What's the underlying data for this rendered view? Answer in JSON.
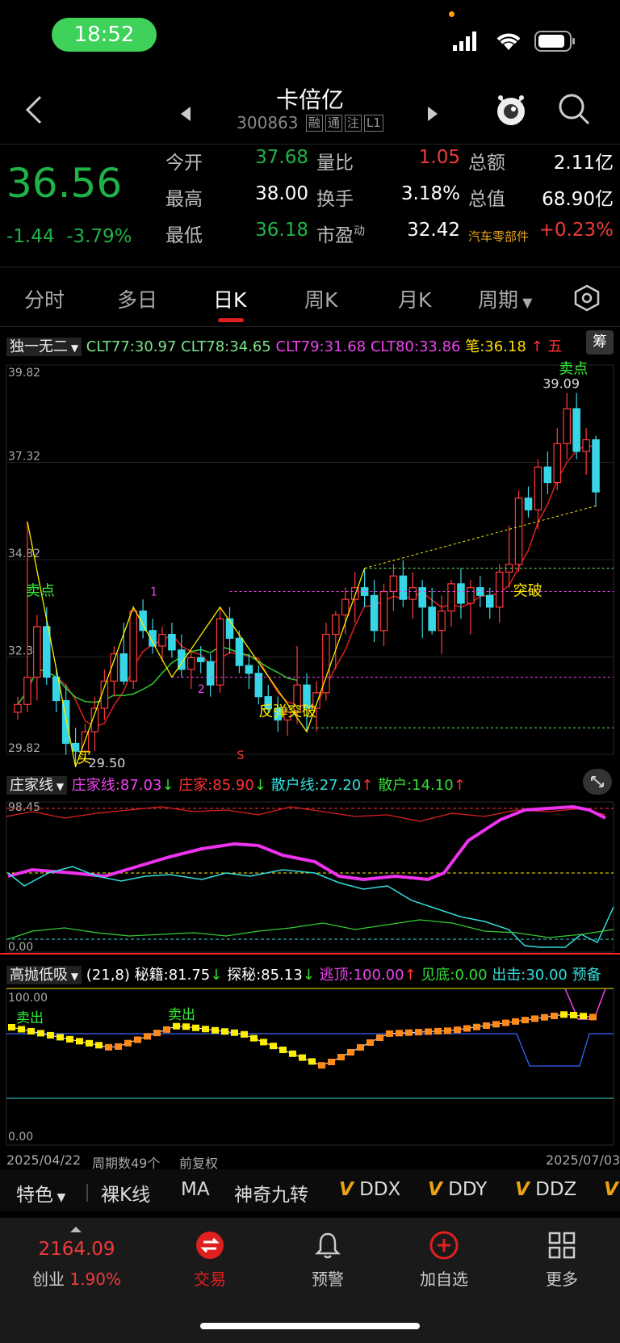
{
  "status_bar": {
    "time": "18:52"
  },
  "header": {
    "title": "卡倍亿",
    "code": "300863",
    "tags": [
      "融",
      "通",
      "注",
      "L1"
    ]
  },
  "quote": {
    "price": "36.56",
    "change": "-1.44",
    "change_pct": "-3.79%",
    "rows": [
      [
        {
          "label": "今开",
          "value": "37.68",
          "color": "#1fb347"
        },
        {
          "label": "量比",
          "value": "1.05",
          "color": "#f03a3a"
        },
        {
          "label": "总额",
          "value": "2.11亿",
          "color": "#ffffff"
        }
      ],
      [
        {
          "label": "最高",
          "value": "38.00",
          "color": "#ffffff"
        },
        {
          "label": "换手",
          "value": "3.18%",
          "color": "#ffffff"
        },
        {
          "label": "总值",
          "value": "68.90亿",
          "color": "#ffffff"
        }
      ],
      [
        {
          "label": "最低",
          "value": "36.18",
          "color": "#1fb347"
        },
        {
          "label": "市盈",
          "value": "32.42",
          "color": "#ffffff"
        },
        {
          "label": "汽车零部件",
          "value": "+0.23%",
          "color": "#f03a3a"
        }
      ]
    ],
    "pe_superscript": "动"
  },
  "tabs": [
    "分时",
    "多日",
    "日K",
    "周K",
    "月K",
    "周期"
  ],
  "main_indicator": {
    "name": "独一无二",
    "values": [
      {
        "text": "CLT77:30.97",
        "color": "#7ee58a"
      },
      {
        "text": "CLT78:34.65",
        "color": "#7ee58a"
      },
      {
        "text": "CLT79:31.68",
        "color": "#ee44ee"
      },
      {
        "text": "CLT80:33.86",
        "color": "#ee44ee"
      },
      {
        "text": "笔:36.18",
        "color": "#ffdd00"
      },
      {
        "text": "↑",
        "color": "#ff3333"
      },
      {
        "text": "五",
        "color": "#ff3333"
      }
    ],
    "calc_button": "筹"
  },
  "chart_data": {
    "type": "candlestick",
    "period": "日K",
    "y_axis_ticks": [
      "39.82",
      "37.32",
      "34.82",
      "32.32",
      "29.82"
    ],
    "ylim": [
      29.82,
      39.82
    ],
    "x_start": "2025/04/22",
    "x_end": "2025/07/03",
    "high_label": "39.09",
    "low_label": "29.50",
    "annotations": [
      {
        "text": "卖点",
        "color": "#33ee33"
      },
      {
        "text": "卖点",
        "color": "#33ee33"
      },
      {
        "text": "反弹突破",
        "color": "#ffee00"
      },
      {
        "text": "突破",
        "color": "#ffee00"
      },
      {
        "text": "买",
        "color": "#ffee00"
      },
      {
        "text": "1",
        "color": "#ee44ee"
      },
      {
        "text": "2",
        "color": "#ee44ee"
      },
      {
        "text": "S",
        "color": "#ff3333"
      }
    ],
    "candles": [
      [
        30.9,
        31.3,
        30.7,
        31.1
      ],
      [
        31.1,
        35.8,
        30.9,
        31.8
      ],
      [
        31.8,
        33.4,
        31.2,
        33.1
      ],
      [
        33.1,
        33.6,
        31.6,
        31.8
      ],
      [
        31.8,
        32.0,
        30.9,
        31.2
      ],
      [
        31.2,
        31.6,
        29.8,
        30.1
      ],
      [
        30.1,
        30.5,
        29.5,
        29.9
      ],
      [
        29.9,
        30.6,
        29.6,
        30.4
      ],
      [
        30.4,
        31.3,
        29.9,
        31.0
      ],
      [
        31.0,
        32.0,
        30.7,
        31.7
      ],
      [
        31.7,
        32.6,
        31.3,
        32.4
      ],
      [
        32.4,
        33.2,
        31.6,
        31.7
      ],
      [
        31.7,
        33.6,
        31.5,
        33.5
      ],
      [
        33.5,
        33.8,
        32.8,
        33.0
      ],
      [
        33.0,
        33.3,
        32.4,
        32.6
      ],
      [
        32.6,
        33.1,
        32.2,
        32.9
      ],
      [
        32.9,
        33.2,
        32.3,
        32.5
      ],
      [
        32.5,
        32.9,
        31.8,
        32.0
      ],
      [
        32.0,
        32.5,
        31.5,
        32.3
      ],
      [
        32.3,
        32.6,
        31.9,
        32.2
      ],
      [
        32.2,
        32.4,
        31.3,
        31.6
      ],
      [
        31.6,
        33.6,
        31.4,
        33.3
      ],
      [
        33.3,
        33.6,
        32.4,
        32.8
      ],
      [
        32.8,
        33.0,
        31.9,
        32.1
      ],
      [
        32.1,
        32.4,
        31.5,
        31.9
      ],
      [
        31.9,
        32.1,
        31.1,
        31.3
      ],
      [
        31.3,
        31.6,
        30.9,
        31.0
      ],
      [
        31.0,
        31.3,
        30.4,
        30.7
      ],
      [
        30.7,
        31.0,
        30.3,
        30.9
      ],
      [
        30.9,
        32.6,
        30.6,
        31.6
      ],
      [
        31.6,
        31.9,
        30.4,
        31.0
      ],
      [
        31.0,
        31.7,
        30.4,
        31.4
      ],
      [
        31.4,
        33.2,
        31.2,
        32.9
      ],
      [
        32.9,
        33.5,
        32.0,
        33.4
      ],
      [
        33.4,
        34.1,
        32.9,
        33.8
      ],
      [
        33.8,
        34.5,
        33.2,
        34.1
      ],
      [
        34.1,
        34.6,
        33.6,
        33.9
      ],
      [
        33.9,
        34.3,
        32.7,
        33.0
      ],
      [
        33.0,
        34.2,
        32.6,
        34.0
      ],
      [
        34.0,
        34.7,
        33.5,
        34.4
      ],
      [
        34.4,
        34.8,
        33.6,
        33.8
      ],
      [
        33.8,
        34.5,
        33.3,
        34.1
      ],
      [
        34.1,
        34.3,
        32.8,
        33.6
      ],
      [
        33.6,
        34.1,
        32.9,
        33.0
      ],
      [
        33.0,
        33.9,
        32.4,
        33.5
      ],
      [
        33.5,
        34.3,
        33.1,
        34.2
      ],
      [
        34.2,
        34.6,
        33.3,
        33.7
      ],
      [
        33.7,
        34.3,
        32.9,
        34.1
      ],
      [
        34.1,
        34.4,
        33.6,
        33.9
      ],
      [
        33.9,
        34.1,
        33.3,
        33.6
      ],
      [
        33.6,
        34.7,
        33.2,
        34.5
      ],
      [
        34.5,
        35.7,
        34.1,
        34.7
      ],
      [
        34.7,
        36.6,
        34.5,
        36.4
      ],
      [
        36.4,
        36.7,
        35.9,
        36.1
      ],
      [
        36.1,
        37.4,
        35.6,
        37.2
      ],
      [
        37.2,
        37.6,
        36.5,
        36.8
      ],
      [
        36.8,
        38.2,
        36.6,
        37.8
      ],
      [
        37.8,
        39.1,
        37.4,
        38.7
      ],
      [
        38.7,
        39.1,
        37.4,
        37.6
      ],
      [
        37.6,
        38.2,
        37.0,
        37.9
      ],
      [
        37.9,
        38.0,
        36.18,
        36.56
      ]
    ]
  },
  "ind1": {
    "name": "庄家线",
    "values": [
      {
        "text": "庄家线:87.03",
        "color": "#ee44ee",
        "arrow": "↓",
        "arrow_color": "#33dd33"
      },
      {
        "text": "庄家:85.90",
        "color": "#ff3333",
        "arrow": "↓",
        "arrow_color": "#33dd33"
      },
      {
        "text": "散户线:27.20",
        "color": "#33dddd",
        "arrow": "↑",
        "arrow_color": "#ff3333"
      },
      {
        "text": "散户:14.10",
        "color": "#33dd33",
        "arrow": "↑",
        "arrow_color": "#ff3333"
      }
    ],
    "y_top": "98.45",
    "y_bottom": "0.00"
  },
  "ind2": {
    "name": "高抛低吸",
    "values": [
      {
        "text": "(21,8)",
        "color": "#ffffff",
        "arrow": "",
        "arrow_color": ""
      },
      {
        "text": "秘籍:81.75",
        "color": "#ffffff",
        "arrow": "↓",
        "arrow_color": "#33dd33"
      },
      {
        "text": "探秘:85.13",
        "color": "#ffffff",
        "arrow": "↓",
        "arrow_color": "#33dd33"
      },
      {
        "text": "逃顶:100.00",
        "color": "#ee44ee",
        "arrow": "↑",
        "arrow_color": "#ff3333"
      },
      {
        "text": "见底:0.00",
        "color": "#33dd33",
        "arrow": "",
        "arrow_color": ""
      },
      {
        "text": "出击:30.00",
        "color": "#33dddd",
        "arrow": "",
        "arrow_color": ""
      },
      {
        "text": "预备",
        "color": "#33dddd",
        "arrow": "",
        "arrow_color": ""
      }
    ],
    "y_top": "100.00",
    "y_bottom": "0.00",
    "labels": [
      "卖出",
      "卖出"
    ]
  },
  "footer_axis": {
    "start": "2025/04/22",
    "count": "周期数49个",
    "adjust": "前复权",
    "end": "2025/07/03"
  },
  "toolbar": {
    "special": "特色",
    "items": [
      "裸K线",
      "MA",
      "神奇九转",
      "DDX",
      "DDY",
      "DDZ"
    ]
  },
  "nav": {
    "index_value": "2164.09",
    "index_name": "创业",
    "index_pct": "1.90%",
    "items": [
      {
        "label": "交易",
        "active": true
      },
      {
        "label": "预警",
        "active": false
      },
      {
        "label": "加自选",
        "active": false
      },
      {
        "label": "更多",
        "active": false
      }
    ]
  }
}
